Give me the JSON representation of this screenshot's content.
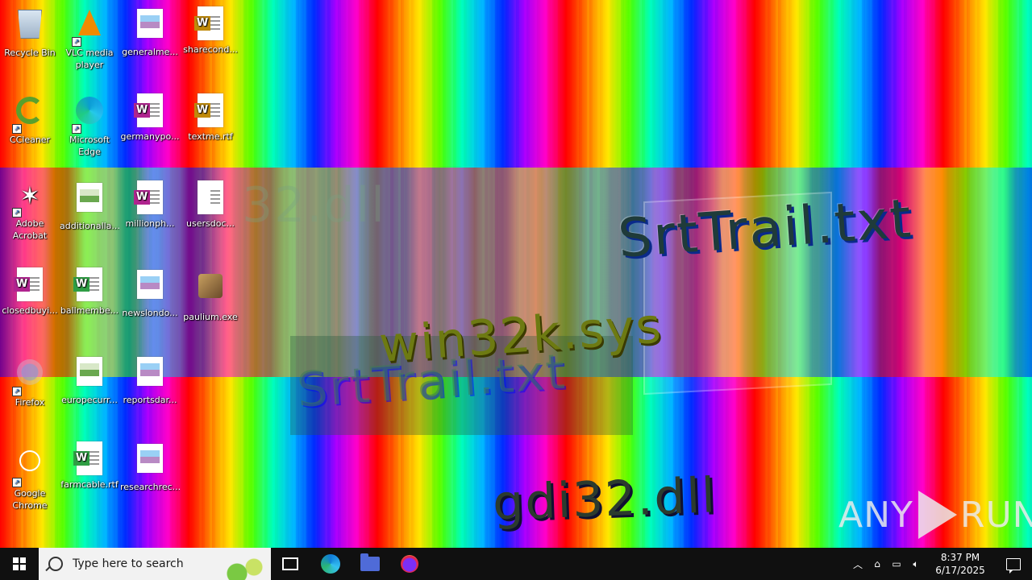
{
  "desktop": {
    "glitch_texts": {
      "srttrail": "SrtTrail.txt",
      "win32k": "win32k.sys",
      "srttrail_ghost": "SrtTrail.txt",
      "gdi32": "gdi32.dll",
      "gdi32_ghost": "32.dll"
    },
    "watermark": {
      "left": "ANY",
      "right": "RUN"
    },
    "icons": [
      {
        "name": "Recycle Bin",
        "icon": "recycle-bin-icon"
      },
      {
        "name": "VLC media player",
        "icon": "vlc-icon"
      },
      {
        "name": "generalme...",
        "icon": "image-file-icon"
      },
      {
        "name": "sharecond...",
        "icon": "rtf-document-icon"
      },
      {
        "name": "CCleaner",
        "icon": "ccleaner-icon"
      },
      {
        "name": "Microsoft Edge",
        "icon": "edge-icon"
      },
      {
        "name": "germanypo...",
        "icon": "word-document-icon"
      },
      {
        "name": "textme.rtf",
        "icon": "rtf-document-icon"
      },
      {
        "name": "Adobe Acrobat",
        "icon": "acrobat-icon"
      },
      {
        "name": "additionalla...",
        "icon": "image-file-icon"
      },
      {
        "name": "millionph...",
        "icon": "word-document-icon"
      },
      {
        "name": "usersdoc...",
        "icon": "document-icon"
      },
      {
        "name": "closedbuyi...",
        "icon": "word-document-icon"
      },
      {
        "name": "ballmembe...",
        "icon": "rtf-document-icon"
      },
      {
        "name": "newslondo...",
        "icon": "image-file-icon"
      },
      {
        "name": "paulium.exe",
        "icon": "installer-icon"
      },
      {
        "name": "Firefox",
        "icon": "firefox-icon"
      },
      {
        "name": "europecurr...",
        "icon": "image-file-icon"
      },
      {
        "name": "reportsdar...",
        "icon": "image-file-icon"
      },
      {
        "name": "Google Chrome",
        "icon": "chrome-icon"
      },
      {
        "name": "farmcable.rtf",
        "icon": "rtf-document-icon"
      },
      {
        "name": "researchrec...",
        "icon": "image-file-icon"
      }
    ]
  },
  "taskbar": {
    "search_placeholder": "Type here to search",
    "pinned": [
      "task-view",
      "microsoft-edge",
      "file-explorer",
      "firefox"
    ],
    "clock": {
      "time": "8:37 PM",
      "date": "6/17/2025"
    }
  }
}
